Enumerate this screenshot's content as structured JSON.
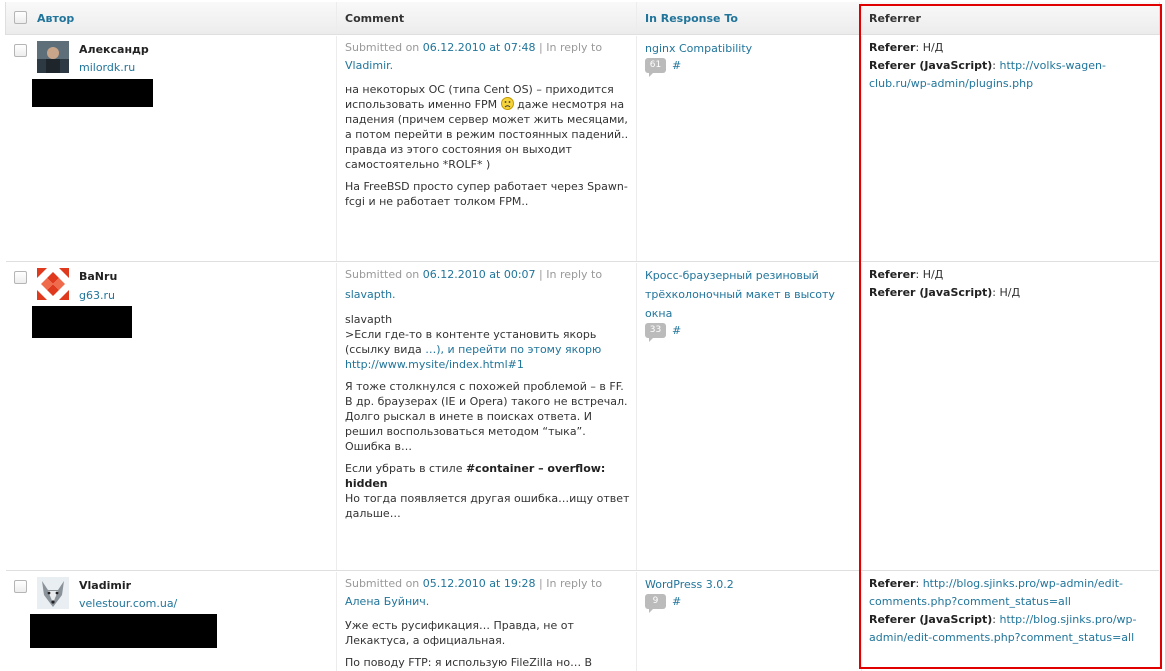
{
  "header": {
    "author": "Автор",
    "comment": "Comment",
    "in_response_to": "In Response To",
    "referrer": "Referrer"
  },
  "rows": [
    {
      "author": {
        "name": "Александр",
        "url": "milordk.ru"
      },
      "submitted_prefix": "Submitted on",
      "date": "06.12.2010 at 07:48",
      "reply_prefix": "| In reply to",
      "reply_to": "Vladimir.",
      "paragraphs": [
        "на некоторых ОС (типа Cent OS) – приходится использовать именно FPM",
        "даже несмотря на падения (причем сервер может жить месяцами, а потом перейти в режим постоянных падений.. правда из этого состояния он выходит самостоятельно *ROLF* )",
        "На FreeBSD просто супер работает через Spawn-fcgi и не работает толком FPM.."
      ],
      "response": {
        "title": "nginx Compatibility",
        "count": "61",
        "hash": "#"
      },
      "referrer": {
        "label1": "Referer",
        "value1": "Н/Д",
        "label2": "Referer (JavaScript)",
        "value2": "http://volks-wagen-club.ru/wp-admin/plugins.php"
      }
    },
    {
      "author": {
        "name": "BaNru",
        "url": "g63.ru"
      },
      "submitted_prefix": "Submitted on",
      "date": "06.12.2010 at 00:07",
      "reply_prefix": "| In reply to",
      "reply_to": "slavapth.",
      "paragraphs": [
        "slavapth",
        ">Если где-то в контенте установить якорь (ссылку вида",
        "…), и перейти по этому якорю",
        "http://www.mysite/index.html#1",
        "Я тоже столкнулся с похожей проблемой – в FF. В др. браузерах (IE и Opera) такого не встречал. Долго рыскал в инете в поисках ответа. И решил воспользоваться методом “тыка”. Ошибка в…",
        "Если убрать в стиле",
        "#container – overflow: hidden",
        "Но тогда появляется другая ошибка…ищу ответ дальше…"
      ],
      "response": {
        "title": "Кросс-браузерный резиновый трёхколоночный макет в высоту окна",
        "count": "33",
        "hash": "#"
      },
      "referrer": {
        "label1": "Referer",
        "value1": "Н/Д",
        "label2": "Referer (JavaScript)",
        "value2": "Н/Д"
      }
    },
    {
      "author": {
        "name": "Vladimir",
        "url": "velestour.com.ua/"
      },
      "submitted_prefix": "Submitted on",
      "date": "05.12.2010 at 19:28",
      "reply_prefix": "| In reply to",
      "reply_to": "Алена Буйнич.",
      "paragraphs": [
        "Уже есть русификация… Правда, не от Лекактуса, а официальная.",
        "По поводу FTP: я использую FileZilla но… В"
      ],
      "response": {
        "title": "WordPress 3.0.2",
        "count": "9",
        "hash": "#"
      },
      "referrer": {
        "label1": "Referer",
        "value1": "http://blog.sjinks.pro/wp-admin/edit-comments.php?comment_status=all",
        "label2": "Referer (JavaScript)",
        "value2": "http://blog.sjinks.pro/wp-admin/edit-comments.php?comment_status=all"
      }
    }
  ]
}
